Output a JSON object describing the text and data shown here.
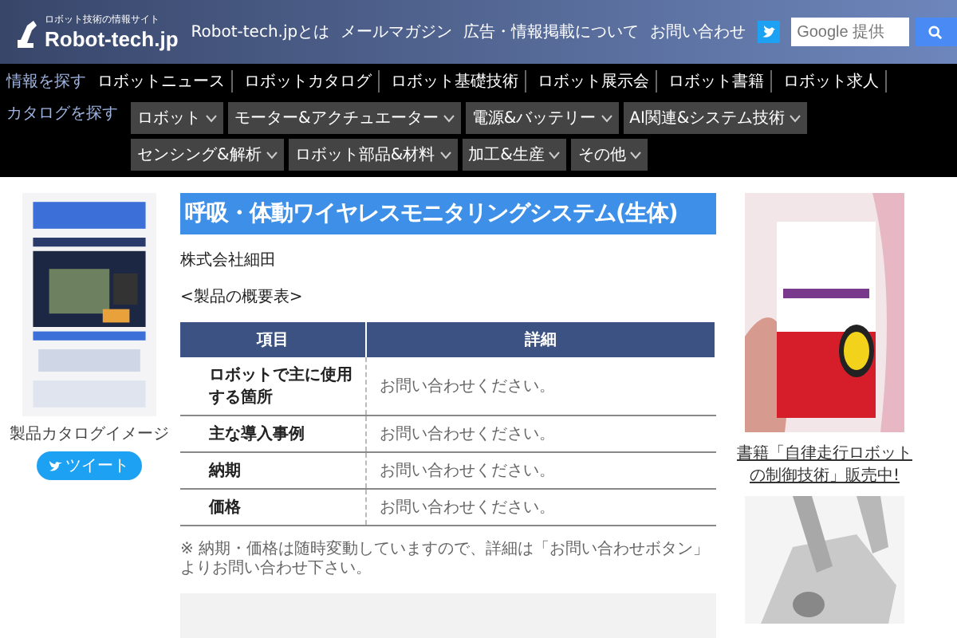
{
  "header": {
    "tagline": "ロボット技術の情報サイト",
    "logo": "Robot-tech.jp",
    "links": [
      "Robot-tech.jpとは",
      "メールマガジン",
      "広告・情報掲載について",
      "お問い合わせ"
    ],
    "search": {
      "placeholder": "Google 提供"
    }
  },
  "nav": {
    "label": "情報を探す",
    "items": [
      "ロボットニュース",
      "ロボットカタログ",
      "ロボット基礎技術",
      "ロボット展示会",
      "ロボット書籍",
      "ロボット求人"
    ]
  },
  "catalog_nav": {
    "label": "カタログを探す",
    "items": [
      "ロボット",
      "モーター&アクチュエーター",
      "電源&バッテリー",
      "AI関連&システム技術",
      "センシング&解析",
      "ロボット部品&材料",
      "加工&生産",
      "その他"
    ]
  },
  "sidebar": {
    "caption": "製品カタログイメージ",
    "tweet": "ツイート"
  },
  "product": {
    "title": "呼吸・体動ワイヤレスモニタリングシステム(生体)",
    "company": "株式会社細田",
    "table_heading": "<製品の概要表>",
    "table": {
      "columns": [
        "項目",
        "詳細"
      ],
      "rows": [
        [
          "ロボットで主に使用する箇所",
          "お問い合わせください。"
        ],
        [
          "主な導入事例",
          "お問い合わせください。"
        ],
        [
          "納期",
          "お問い合わせください。"
        ],
        [
          "価格",
          "お問い合わせください。"
        ]
      ]
    },
    "note": "※ 納期・価格は随時変動していますので、詳細は「お問い合わせボタン」よりお問い合わせ下さい。"
  },
  "aside": {
    "book_link": "書籍「自律走行ロボットの制御技術」販売中!"
  }
}
